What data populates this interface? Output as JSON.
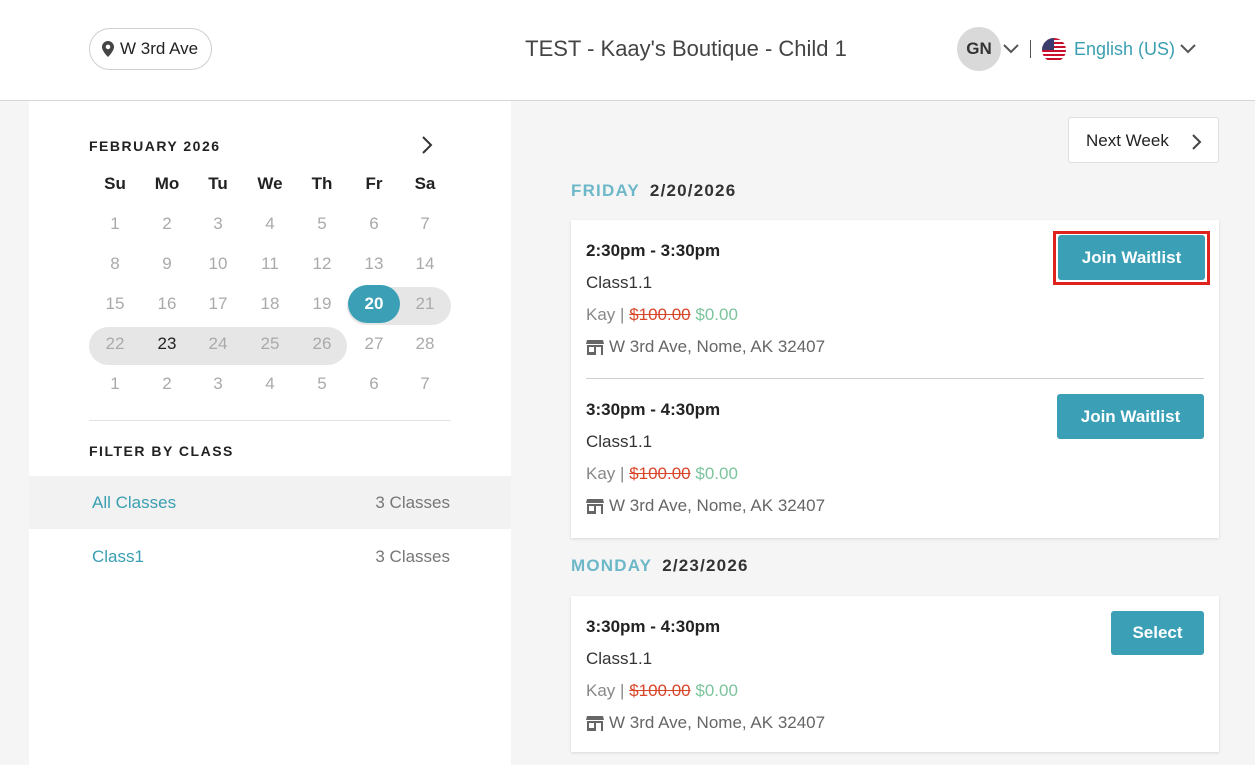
{
  "header": {
    "location": "W 3rd Ave",
    "title": "TEST - Kaay's Boutique - Child 1",
    "avatar_initials": "GN",
    "language": "English (US)"
  },
  "calendar": {
    "month": "FEBRUARY 2026",
    "weekdays": [
      "Su",
      "Mo",
      "Tu",
      "We",
      "Th",
      "Fr",
      "Sa"
    ],
    "weeks": [
      [
        "1",
        "2",
        "3",
        "4",
        "5",
        "6",
        "7"
      ],
      [
        "8",
        "9",
        "10",
        "11",
        "12",
        "13",
        "14"
      ],
      [
        "15",
        "16",
        "17",
        "18",
        "19",
        "20",
        "21"
      ],
      [
        "22",
        "23",
        "24",
        "25",
        "26",
        "27",
        "28"
      ],
      [
        "1",
        "2",
        "3",
        "4",
        "5",
        "6",
        "7"
      ]
    ],
    "selected_day": "20",
    "accent_color": "#3ba0b6"
  },
  "filter": {
    "label": "FILTER BY CLASS",
    "items": [
      {
        "name": "All Classes",
        "count": "3 Classes"
      },
      {
        "name": "Class1",
        "count": "3 Classes"
      }
    ]
  },
  "schedule": {
    "next_week_label": "Next Week",
    "days": [
      {
        "day_name": "FRIDAY",
        "date": "2/20/2026",
        "slots": [
          {
            "time": "2:30pm - 3:30pm",
            "class_name": "Class1.1",
            "instructor": "Kay",
            "separator": "|",
            "original_price": "$100.00",
            "price": "$0.00",
            "address": "W 3rd Ave, Nome, AK 32407",
            "button": "Join Waitlist"
          },
          {
            "time": "3:30pm - 4:30pm",
            "class_name": "Class1.1",
            "instructor": "Kay",
            "separator": "|",
            "original_price": "$100.00",
            "price": "$0.00",
            "address": "W 3rd Ave, Nome, AK 32407",
            "button": "Join Waitlist"
          }
        ]
      },
      {
        "day_name": "MONDAY",
        "date": "2/23/2026",
        "slots": [
          {
            "time": "3:30pm - 4:30pm",
            "class_name": "Class1.1",
            "instructor": "Kay",
            "separator": "|",
            "original_price": "$100.00",
            "price": "$0.00",
            "address": "W 3rd Ave, Nome, AK 32407",
            "button": "Select"
          }
        ]
      }
    ]
  }
}
